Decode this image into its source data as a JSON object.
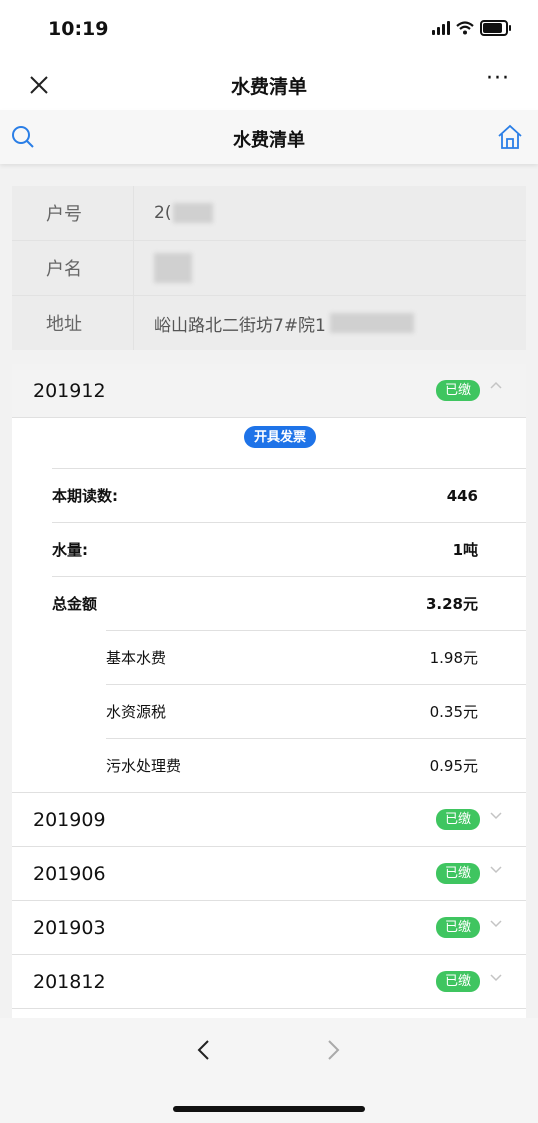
{
  "status": {
    "time": "10:19"
  },
  "nav": {
    "title": "水费清单",
    "more": "···"
  },
  "header": {
    "title": "水费清单"
  },
  "account": {
    "rows": [
      {
        "label": "户号",
        "value": "2("
      },
      {
        "label": "户名",
        "value": ""
      },
      {
        "label": "地址",
        "value": "峪山路北二街坊7#院1"
      }
    ]
  },
  "bills": {
    "open": {
      "period": "201912",
      "status": "已缴",
      "invoice": "开具发票",
      "details": [
        {
          "label": "本期读数:",
          "value": "446"
        },
        {
          "label": "水量:",
          "value": "1吨"
        },
        {
          "label": "总金额",
          "value": "3.28元"
        }
      ],
      "subdetails": [
        {
          "label": "基本水费",
          "value": "1.98元"
        },
        {
          "label": "水资源税",
          "value": "0.35元"
        },
        {
          "label": "污水处理费",
          "value": "0.95元"
        }
      ]
    },
    "collapsed": [
      {
        "period": "201909",
        "status": "已缴"
      },
      {
        "period": "201906",
        "status": "已缴"
      },
      {
        "period": "201903",
        "status": "已缴"
      },
      {
        "period": "201812",
        "status": "已缴"
      }
    ]
  },
  "icons": {
    "close": "close-icon",
    "search": "search-icon",
    "home": "home-icon",
    "back": "chevron-left-icon",
    "forward": "chevron-right-icon"
  },
  "colors": {
    "badge": "#3fc560",
    "invoice": "#1e73e8",
    "accent": "#2a7ee6"
  }
}
